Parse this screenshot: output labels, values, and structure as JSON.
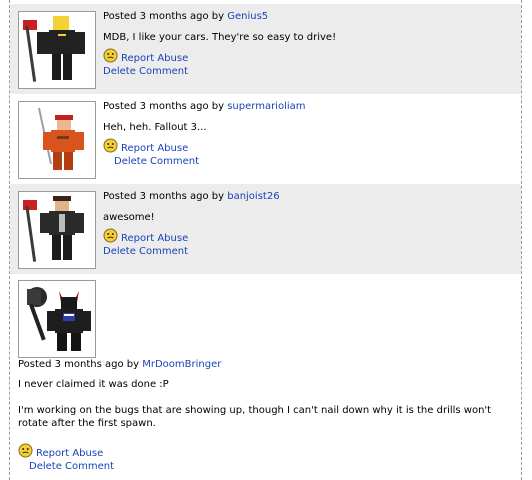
{
  "comments": [
    {
      "posted_prefix": "Posted 3 months ago by",
      "username": "Genius5",
      "lines": [
        "MDB, I like your cars. They're so easy to drive!"
      ],
      "report_label": "Report Abuse",
      "delete_label": "Delete Comment",
      "shaded": true
    },
    {
      "posted_prefix": "Posted 3 months ago by",
      "username": "supermarioliam",
      "lines": [
        "Heh, heh. Fallout 3..."
      ],
      "report_label": "Report Abuse",
      "delete_label": "Delete Comment",
      "shaded": false
    },
    {
      "posted_prefix": "Posted 3 months ago by",
      "username": "banjoist26",
      "lines": [
        "awesome!"
      ],
      "report_label": "Report Abuse",
      "delete_label": "Delete Comment",
      "shaded": true
    },
    {
      "posted_prefix": "Posted 3 months ago by",
      "username": "MrDoomBringer",
      "lines": [
        "I never claimed it was done :P",
        "I'm working on the bugs that are showing up, though I can't nail down why it is the drills won't rotate after the first spawn."
      ],
      "report_label": "Report Abuse",
      "delete_label": "Delete Comment",
      "shaded": false
    }
  ],
  "colors": {
    "link": "#1a43b8",
    "shaded_row": "#ececec",
    "frame_border": "#9a9a9a"
  },
  "icons": {
    "report": "smiley-icon"
  }
}
